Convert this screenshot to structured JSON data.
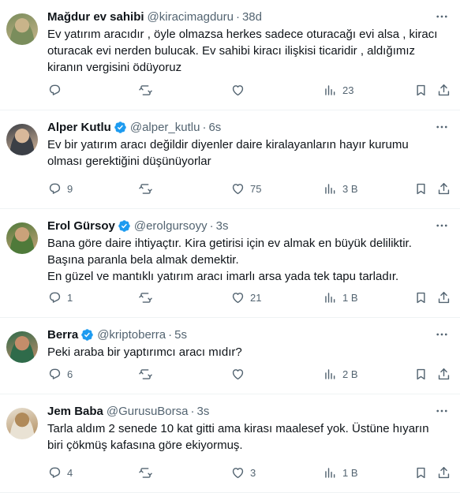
{
  "tweets": [
    {
      "name": "Mağdur ev sahibi",
      "verified": false,
      "handle": "@kiracimagduru",
      "time": "38d",
      "text": "Ev yatırım aracıdır , öyle olmazsa herkes sadece oturacağı evi alsa , kiracı\noturacak evi nerden bulucak. Ev sahibi kiracı ilişkisi ticaridir , aldığımız\nkiranın vergisini ödüyoruz",
      "replies": "",
      "retweets": "",
      "likes": "",
      "views": "23",
      "avatar_colors": [
        "#7a8d5c",
        "#c9b48a"
      ]
    },
    {
      "name": "Alper Kutlu",
      "verified": true,
      "handle": "@alper_kutlu",
      "time": "6s",
      "text": "Ev bir yatırım aracı değildir diyenler daire kiralayanların hayır kurumu\nolması gerektiğini düşünüyorlar",
      "replies": "9",
      "retweets": "",
      "likes": "75",
      "views": "3 B",
      "avatar_colors": [
        "#3b3f46",
        "#d8b89a"
      ]
    },
    {
      "name": "Erol Gürsoy",
      "verified": true,
      "handle": "@erolgursoyy",
      "time": "3s",
      "text": "Bana göre daire ihtiyaçtır. Kira getirisi için ev almak en büyük deliliktir.\nBaşına paranla bela almak demektir.\nEn güzel ve mantıklı yatırım aracı imarlı arsa yada tek tapu tarladır.",
      "replies": "1",
      "retweets": "",
      "likes": "21",
      "views": "1 B",
      "avatar_colors": [
        "#4f7a3a",
        "#caa27a"
      ]
    },
    {
      "name": "Berra",
      "verified": true,
      "handle": "@kriptoberra",
      "time": "5s",
      "text": "Peki araba bir yaptırımcı aracı mıdır?",
      "replies": "6",
      "retweets": "",
      "likes": "",
      "views": "2 B",
      "avatar_colors": [
        "#2f6b4a",
        "#c48d6a"
      ]
    },
    {
      "name": "Jem Baba",
      "verified": false,
      "handle": "@GurusuBorsa",
      "time": "3s",
      "text": "Tarla aldım 2 senede 10 kat gitti ama kirası maalesef yok. Üstüne hıyarın\nbiri çökmüş kafasına göre ekiyormuş.",
      "replies": "4",
      "retweets": "",
      "likes": "3",
      "views": "1 B",
      "avatar_colors": [
        "#e9e2d4",
        "#b08a5a"
      ]
    }
  ],
  "colors": {
    "text": "#0f1419",
    "secondary": "#536471",
    "verified": "#1d9bf0",
    "divider": "#eff3f4"
  },
  "icons": {
    "reply": "reply-icon",
    "retweet": "retweet-icon",
    "like": "heart-icon",
    "views": "views-icon",
    "bookmark": "bookmark-icon",
    "share": "share-icon",
    "more": "more-icon",
    "verified": "verified-badge-icon"
  }
}
